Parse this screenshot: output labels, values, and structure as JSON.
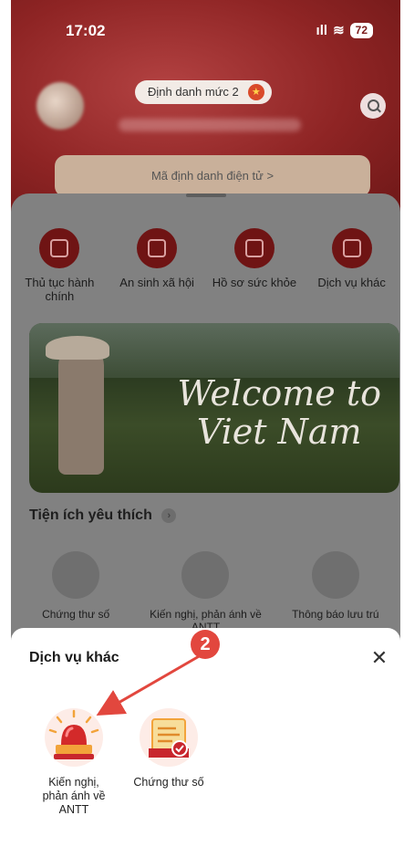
{
  "status_bar": {
    "time": "17:02",
    "signal": "ıll",
    "wifi": "≋",
    "battery": "72"
  },
  "header": {
    "badge": "Định danh mức 2",
    "electronic_id_label": "Mã định danh điện tử  >"
  },
  "categories": [
    {
      "label": "Thủ tục hành chính",
      "icon": "government-building-icon"
    },
    {
      "label": "An sinh xã hội",
      "icon": "social-security-icon"
    },
    {
      "label": "Hồ sơ sức khỏe",
      "icon": "health-record-icon"
    },
    {
      "label": "Dịch vụ khác",
      "icon": "other-services-icon"
    }
  ],
  "banner": {
    "line1": "Welcome to",
    "line2": "Viet Nam"
  },
  "favorites": {
    "title": "Tiện ích yêu thích",
    "items": [
      {
        "label": "Chứng thư số",
        "icon": "certificate-icon"
      },
      {
        "label": "Kiến nghị, phản ánh về ANTT",
        "icon": "alarm-siren-icon"
      },
      {
        "label": "Thông báo lưu trú",
        "icon": "residence-notice-icon"
      }
    ]
  },
  "sheet": {
    "title": "Dịch vụ khác",
    "close": "✕",
    "items": [
      {
        "label": "Kiến nghị, phản ánh về ANTT",
        "icon": "alarm-siren-icon"
      },
      {
        "label": "Chứng thư số",
        "icon": "certificate-icon"
      }
    ]
  },
  "annotation": {
    "step": "2"
  },
  "colors": {
    "brand_red": "#c8262d",
    "accent_orange": "#f2a33a",
    "annotation_red": "#e2473e"
  }
}
